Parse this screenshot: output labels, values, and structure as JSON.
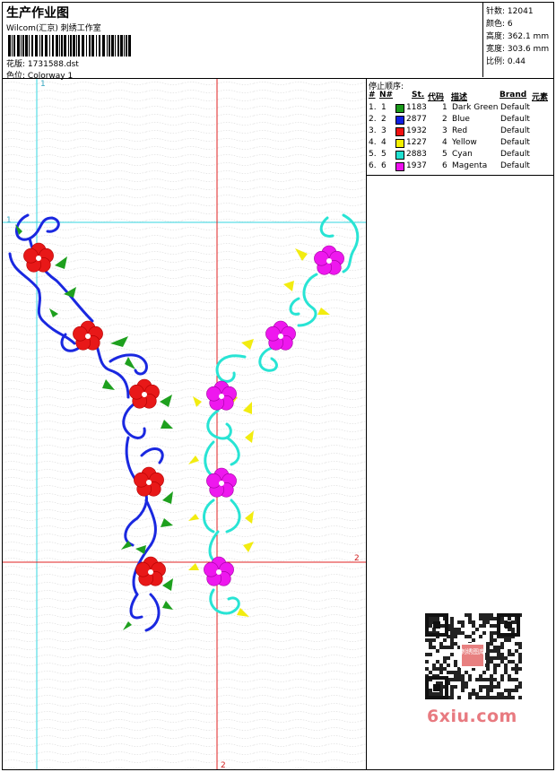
{
  "header": {
    "title": "生产作业图",
    "company": "Wilcom(汇京) 刺绣工作室",
    "design_label": "花版:",
    "design_value": "1731588.dst",
    "colorway_label": "色位:",
    "colorway_value": "Colorway 1"
  },
  "stats": [
    {
      "label": "针数:",
      "value": "12041"
    },
    {
      "label": "颜色:",
      "value": "6"
    },
    {
      "label": "高度:",
      "value": "362.1 mm"
    },
    {
      "label": "宽度:",
      "value": "303.6 mm"
    },
    {
      "label": "比例:",
      "value": "0.44"
    }
  ],
  "stop_panel": {
    "title": "停止顺序:",
    "columns": {
      "num": "#",
      "n": "N#",
      "st": "St.",
      "code": "代码",
      "desc": "描述",
      "brand": "Brand",
      "elem": "元素"
    },
    "rows": [
      {
        "num": "1.",
        "n": "1",
        "color": "#1a9a1a",
        "st": "1183",
        "code": "1",
        "desc": "Dark Green",
        "brand": "Default"
      },
      {
        "num": "2.",
        "n": "2",
        "color": "#1020e0",
        "st": "2877",
        "code": "2",
        "desc": "Blue",
        "brand": "Default"
      },
      {
        "num": "3.",
        "n": "3",
        "color": "#f01010",
        "st": "1932",
        "code": "3",
        "desc": "Red",
        "brand": "Default"
      },
      {
        "num": "4.",
        "n": "4",
        "color": "#f4f000",
        "st": "1227",
        "code": "4",
        "desc": "Yellow",
        "brand": "Default"
      },
      {
        "num": "5.",
        "n": "5",
        "color": "#20e0d0",
        "st": "2883",
        "code": "5",
        "desc": "Cyan",
        "brand": "Default"
      },
      {
        "num": "6.",
        "n": "6",
        "color": "#ee10ee",
        "st": "1937",
        "code": "6",
        "desc": "Magenta",
        "brand": "Default"
      }
    ]
  },
  "guides": {
    "label_1": "1",
    "label_2": "2"
  },
  "watermark": {
    "text": "6xiu.com",
    "qr_caption": "刺绣图库"
  }
}
